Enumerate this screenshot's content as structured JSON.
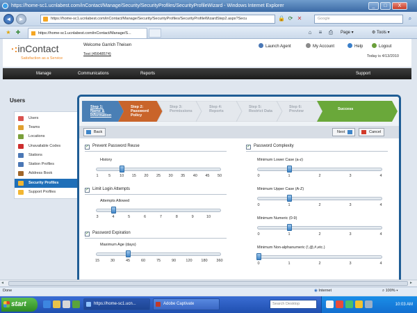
{
  "window": {
    "title": "https://home-sc1.ucnlabest.com/inContact/Manage/Security/SecurityProfiles/SecurityProfileWizard - Windows Internet Explorer",
    "controls": [
      "_",
      "□",
      "X"
    ]
  },
  "addressbar": {
    "url": "https://home-sc1.ucnlabest.com/inContact/Manage/Security/SecurityProfiles/SecurityProfileWizardStep2.aspx?Secu",
    "search_placeholder": "Google"
  },
  "tabbar": {
    "tab_title": "https://home-sc1.ucnlabest.com/inContact/Manage/S...",
    "commands": [
      "Page",
      "Tools"
    ]
  },
  "header": {
    "logo_text": "inContact",
    "logo_dots": "·:",
    "logo_tagline": "Satisfaction as a Service",
    "welcome": "Welcome Garrich Theisen",
    "account": "Test (45648574)",
    "links": [
      "Launch Agent",
      "My Account",
      "Help",
      "Logout"
    ],
    "today": "Today is 4/13/2010"
  },
  "nav": {
    "items": [
      "Manage",
      "Communications",
      "Reports",
      "Support"
    ]
  },
  "sidebar": {
    "title": "Users",
    "items": [
      {
        "label": "Users",
        "icon": "users-icon",
        "color": "#d9534f"
      },
      {
        "label": "Teams",
        "icon": "teams-icon",
        "color": "#e0a030"
      },
      {
        "label": "Locations",
        "icon": "locations-icon",
        "color": "#7a9f3a"
      },
      {
        "label": "Unavailable Codes",
        "icon": "unavailable-codes-icon",
        "color": "#cc2e2e"
      },
      {
        "label": "Stations",
        "icon": "stations-icon",
        "color": "#4a77b5"
      },
      {
        "label": "Station Profiles",
        "icon": "station-profiles-icon",
        "color": "#4a77b5"
      },
      {
        "label": "Address Book",
        "icon": "address-book-icon",
        "color": "#a0662a"
      },
      {
        "label": "Security Profiles",
        "icon": "security-profiles-icon",
        "color": "#f2b632",
        "active": true
      },
      {
        "label": "Support Profiles",
        "icon": "support-profiles-icon",
        "color": "#f2b632"
      }
    ]
  },
  "wizard": {
    "steps": [
      {
        "label": "Step 1:\nName &\nInformation",
        "state": "done"
      },
      {
        "label": "Step 2:\nPassword\nPolicy",
        "state": "current"
      },
      {
        "label": "Step 3:\nPermissions",
        "state": "todo"
      },
      {
        "label": "Step 4:\nReports",
        "state": "todo"
      },
      {
        "label": "Step 5:\nRestrict Data",
        "state": "todo"
      },
      {
        "label": "Step 6:\nPreview",
        "state": "todo"
      },
      {
        "label": "Success",
        "state": "success"
      }
    ],
    "back_label": "Back",
    "next_label": "Next",
    "cancel_label": "Cancel",
    "left": [
      {
        "title": "Prevent Password Reuse",
        "checked": true,
        "slider_label": "History",
        "ticks": [
          "1",
          "5",
          "10",
          "15",
          "20",
          "25",
          "30",
          "35",
          "40",
          "45",
          "50"
        ],
        "value_index": 2
      },
      {
        "title": "Limit Login Attempts",
        "checked": true,
        "slider_label": "Attempts Allowed",
        "ticks": [
          "3",
          "4",
          "5",
          "6",
          "7",
          "8",
          "9",
          "10"
        ],
        "value_index": 1
      },
      {
        "title": "Password Expiration",
        "checked": true,
        "slider_label": "Maximum Age (days)",
        "ticks": [
          "15",
          "30",
          "45",
          "60",
          "75",
          "90",
          "120",
          "180",
          "360"
        ],
        "value_index": 2
      }
    ],
    "right": {
      "title": "Password Complexity",
      "checked": true,
      "sliders": [
        {
          "label": "Minimum Lower Case (a-z)",
          "ticks": [
            "0",
            "1",
            "2",
            "3",
            "4"
          ],
          "value_index": 1
        },
        {
          "label": "Minimum Upper Case (A-Z)",
          "ticks": [
            "0",
            "1",
            "2",
            "3",
            "4"
          ],
          "value_index": 1
        },
        {
          "label": "Minimum Numeric (0-9)",
          "ticks": [
            "0",
            "1",
            "2",
            "3",
            "4"
          ],
          "value_index": 1
        },
        {
          "label": "Minimum Non-alphanumeric (!,@,#,etc.)",
          "ticks": [
            "0",
            "1",
            "2",
            "3",
            "4"
          ],
          "value_index": 0
        }
      ]
    }
  },
  "status": {
    "left": "Done",
    "zone": "Internet",
    "zoom": "100%"
  },
  "taskbar": {
    "start": "start",
    "items": [
      "https://home-sc1.ucn...",
      "Adobe Captivate"
    ],
    "search_placeholder": "Search Desktop",
    "clock": "10:03 AM"
  },
  "colors": {
    "accent": "#1f5d95",
    "step_done": "#4a7fb5",
    "step_current": "#c9642a",
    "step_success": "#6aa83a"
  }
}
